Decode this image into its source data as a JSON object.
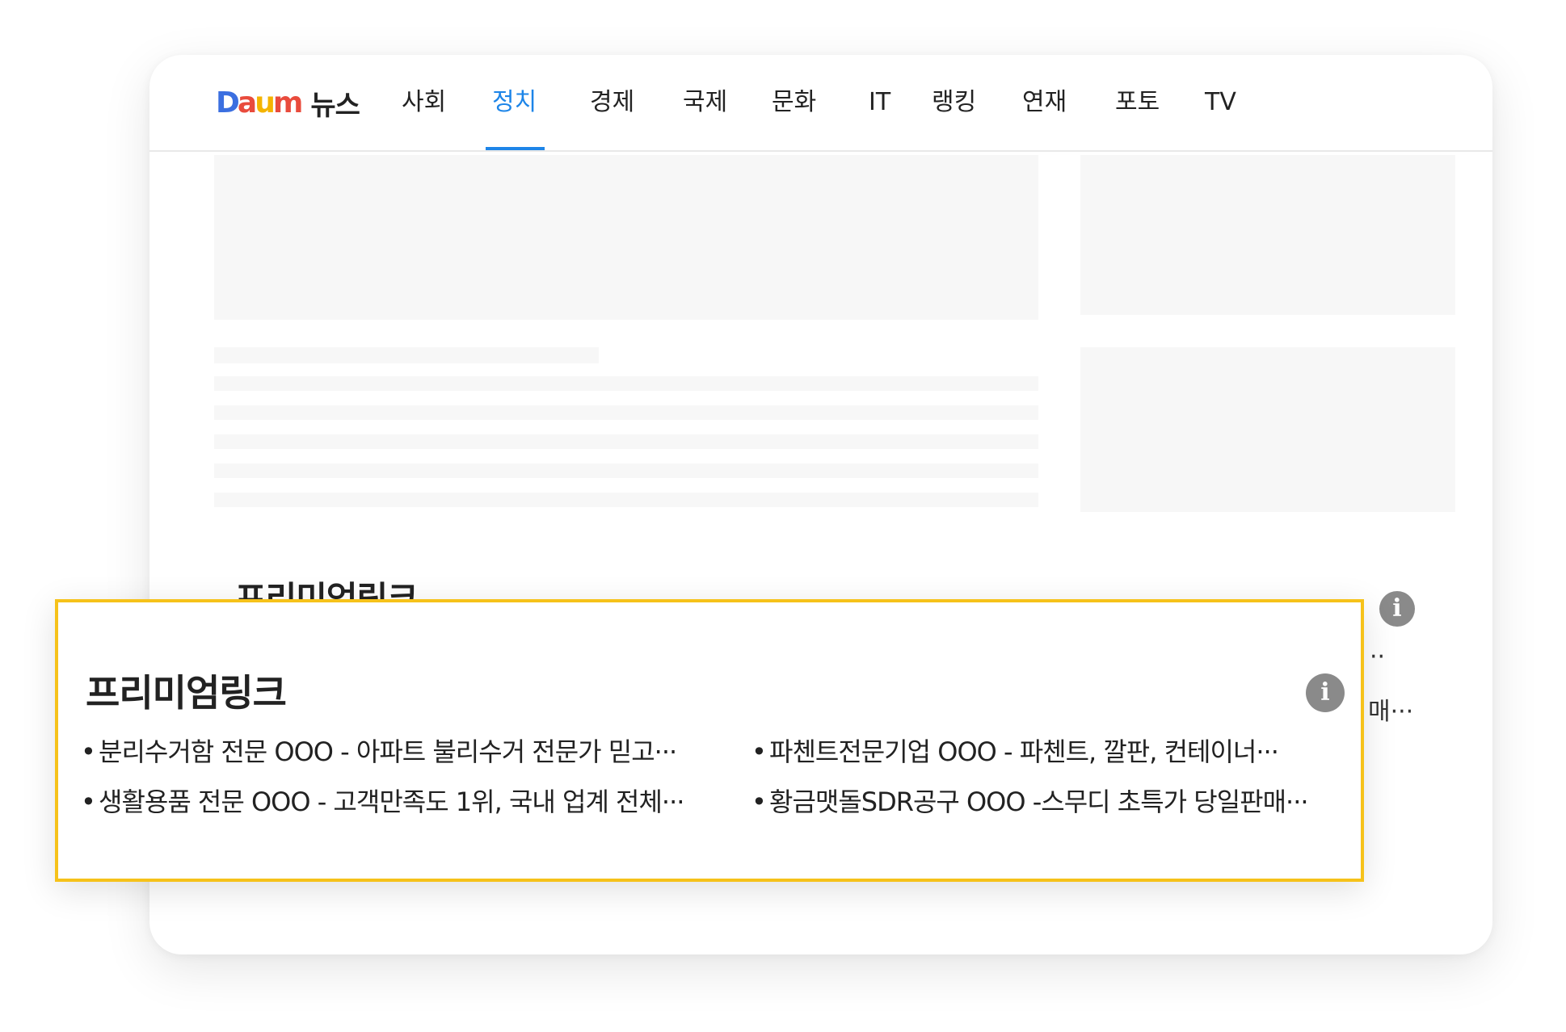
{
  "logo": {
    "letters": [
      {
        "char": "D",
        "color": "#3b6fe0"
      },
      {
        "char": "a",
        "color": "#e94b3c"
      },
      {
        "char": "u",
        "color": "#f4b400"
      },
      {
        "char": "m",
        "color": "#e94b3c"
      }
    ],
    "service": "뉴스"
  },
  "nav": {
    "items": [
      {
        "label": "사회"
      },
      {
        "label": "정치",
        "active": true
      },
      {
        "label": "경제"
      },
      {
        "label": "국제"
      },
      {
        "label": "문화"
      },
      {
        "label": "IT"
      },
      {
        "label": "랭킹"
      },
      {
        "label": "연재"
      },
      {
        "label": "포토"
      },
      {
        "label": "TV"
      }
    ],
    "active_color": "#1d85e8"
  },
  "premium": {
    "title": "프리미엄링크",
    "peek": [
      "··",
      "매···"
    ],
    "links": [
      "분리수거함 전문 OOO - 아파트 불리수거 전문가 믿고···",
      "파첸트전문기업 OOO - 파첸트, 깔판, 컨테이너···",
      "생활용품 전문 OOO - 고객만족도 1위, 국내 업계 전체···",
      "황금맷돌SDR공구 OOO -스무디 초특가 당일판매···"
    ],
    "bullet": "•",
    "info_icon": "info-icon",
    "highlight_color": "#f6c21a"
  }
}
